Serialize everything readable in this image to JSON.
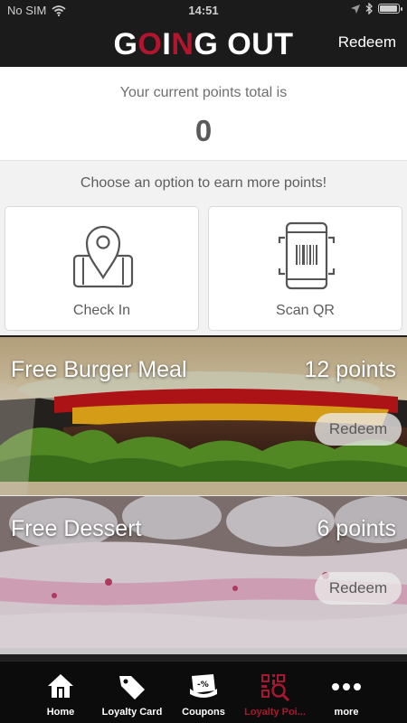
{
  "status_bar": {
    "carrier": "No SIM",
    "time": "14:51"
  },
  "header": {
    "brand_part1": "G",
    "brand_accent1": "O",
    "brand_part2": "I",
    "brand_accent2": "N",
    "brand_part3": "G OUT",
    "redeem_link": "Redeem",
    "accent_color": "#b2162e"
  },
  "points": {
    "label": "Your current points total is",
    "value": "0"
  },
  "options": {
    "prompt": "Choose an option to earn more points!",
    "items": [
      {
        "label": "Check In",
        "icon": "map-pin-phone-icon"
      },
      {
        "label": "Scan QR",
        "icon": "qr-scan-phone-icon"
      }
    ]
  },
  "rewards": [
    {
      "title": "Free Burger Meal",
      "points": "12 points",
      "action": "Redeem"
    },
    {
      "title": "Free Dessert",
      "points": "6 points",
      "action": "Redeem"
    }
  ],
  "tabs": [
    {
      "label": "Home",
      "icon": "home-icon",
      "active": false
    },
    {
      "label": "Loyalty Card",
      "icon": "tag-icon",
      "active": false
    },
    {
      "label": "Coupons",
      "icon": "coupon-icon",
      "active": false
    },
    {
      "label": "Loyalty Poi...",
      "icon": "qr-search-icon",
      "active": true
    },
    {
      "label": "more",
      "icon": "more-dots-icon",
      "active": false
    }
  ]
}
